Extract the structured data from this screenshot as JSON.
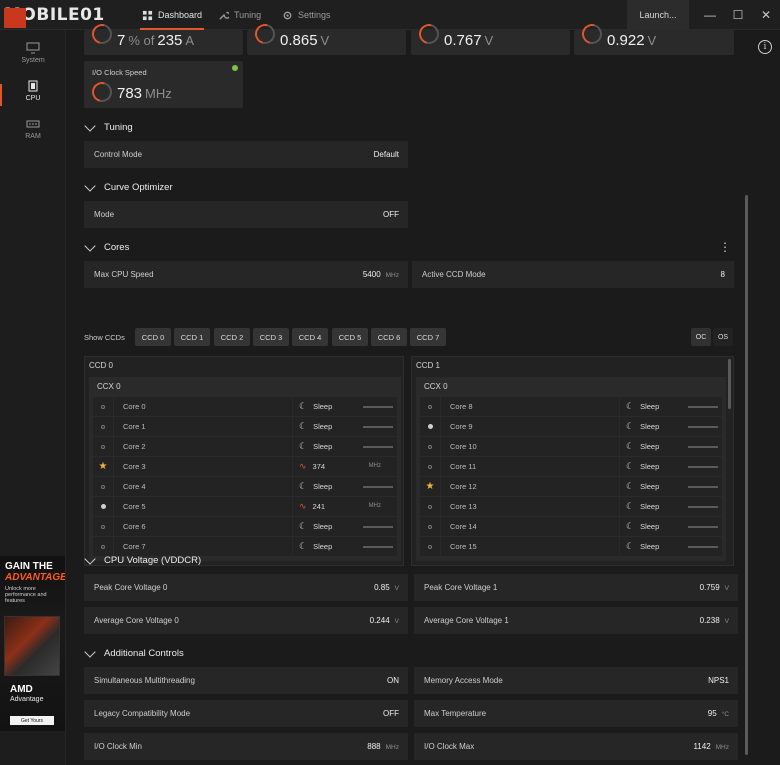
{
  "titlebar": {
    "watermark": "MOBILE01",
    "tabs": [
      {
        "label": "Dashboard",
        "icon": "grid-icon"
      },
      {
        "label": "Tuning",
        "icon": "wrench-icon"
      },
      {
        "label": "Settings",
        "icon": "gear-icon"
      }
    ],
    "launch_label": "Launch...",
    "controls": {
      "minimize": "—",
      "maximize": "☐",
      "close": "✕"
    }
  },
  "sidebar": {
    "items": [
      {
        "label": "System",
        "icon": "monitor-icon"
      },
      {
        "label": "CPU",
        "icon": "cpu-icon"
      },
      {
        "label": "RAM",
        "icon": "memory-icon"
      }
    ]
  },
  "ad": {
    "headline1": "GAIN THE",
    "headline2": "ADVANTAGE",
    "sub": "Unlock more performance and features",
    "brand": "AMD",
    "brand2": "Advantage",
    "button": "Get Yours"
  },
  "gauges": {
    "current": {
      "value": "7",
      "of": "% of",
      "max": "235",
      "unit": "A"
    },
    "v1": {
      "value": "0.865",
      "unit": "V"
    },
    "v2": {
      "value": "0.767",
      "unit": "V"
    },
    "v3": {
      "value": "0.922",
      "unit": "V"
    },
    "io_clock": {
      "label": "I/O Clock Speed",
      "value": "783",
      "unit": "MHz"
    }
  },
  "tuning": {
    "title": "Tuning",
    "control_mode_label": "Control Mode",
    "control_mode_value": "Default"
  },
  "curve": {
    "title": "Curve Optimizer",
    "mode_label": "Mode",
    "mode_value": "OFF"
  },
  "cores": {
    "title": "Cores",
    "max_speed_label": "Max CPU Speed",
    "max_speed_value": "5400",
    "max_speed_unit": "MHz",
    "active_ccd_label": "Active CCD Mode",
    "active_ccd_value": "8",
    "show_ccds_label": "Show CCDs",
    "ccd_buttons": [
      "CCD 0",
      "CCD 1",
      "CCD 2",
      "CCD 3",
      "CCD 4",
      "CCD 5",
      "CCD 6",
      "CCD 7"
    ],
    "oc_label": "OC",
    "os_label": "OS",
    "ccd0": {
      "title": "CCD 0",
      "ccx": "CCX 0",
      "rows": [
        {
          "name": "Core 0",
          "marker": "hollow",
          "state": "Sleep",
          "mhz": ""
        },
        {
          "name": "Core 1",
          "marker": "hollow",
          "state": "Sleep",
          "mhz": ""
        },
        {
          "name": "Core 2",
          "marker": "hollow",
          "state": "Sleep",
          "mhz": ""
        },
        {
          "name": "Core 3",
          "marker": "star",
          "state": "374",
          "mhz": "MHz"
        },
        {
          "name": "Core 4",
          "marker": "hollow",
          "state": "Sleep",
          "mhz": ""
        },
        {
          "name": "Core 5",
          "marker": "filled",
          "state": "241",
          "mhz": "MHz"
        },
        {
          "name": "Core 6",
          "marker": "hollow",
          "state": "Sleep",
          "mhz": ""
        },
        {
          "name": "Core 7",
          "marker": "hollow",
          "state": "Sleep",
          "mhz": ""
        }
      ]
    },
    "ccd1": {
      "title": "CCD 1",
      "ccx": "CCX 0",
      "rows": [
        {
          "name": "Core 8",
          "marker": "hollow",
          "state": "Sleep",
          "mhz": ""
        },
        {
          "name": "Core 9",
          "marker": "filled",
          "state": "Sleep",
          "mhz": ""
        },
        {
          "name": "Core 10",
          "marker": "hollow",
          "state": "Sleep",
          "mhz": ""
        },
        {
          "name": "Core 11",
          "marker": "hollow",
          "state": "Sleep",
          "mhz": ""
        },
        {
          "name": "Core 12",
          "marker": "star",
          "state": "Sleep",
          "mhz": ""
        },
        {
          "name": "Core 13",
          "marker": "hollow",
          "state": "Sleep",
          "mhz": ""
        },
        {
          "name": "Core 14",
          "marker": "hollow",
          "state": "Sleep",
          "mhz": ""
        },
        {
          "name": "Core 15",
          "marker": "hollow",
          "state": "Sleep",
          "mhz": ""
        }
      ]
    }
  },
  "voltage": {
    "title": "CPU Voltage (VDDCR)",
    "peak0_label": "Peak Core Voltage 0",
    "peak0_value": "0.85",
    "peak0_unit": "V",
    "peak1_label": "Peak Core Voltage 1",
    "peak1_value": "0.759",
    "peak1_unit": "V",
    "avg0_label": "Average Core Voltage 0",
    "avg0_value": "0.244",
    "avg0_unit": "V",
    "avg1_label": "Average Core Voltage 1",
    "avg1_value": "0.238",
    "avg1_unit": "V"
  },
  "additional": {
    "title": "Additional Controls",
    "smt_label": "Simultaneous Multithreading",
    "smt_value": "ON",
    "mem_label": "Memory Access Mode",
    "mem_value": "NPS1",
    "legacy_label": "Legacy Compatibility Mode",
    "legacy_value": "OFF",
    "maxtemp_label": "Max Temperature",
    "maxtemp_value": "95",
    "maxtemp_unit": "°C",
    "ioclkmin_label": "I/O Clock Min",
    "ioclkmin_value": "888",
    "ioclkmin_unit": "MHz",
    "ioclkmax_label": "I/O Clock Max",
    "ioclkmax_value": "1142",
    "ioclkmax_unit": "MHz"
  },
  "colors": {
    "accent": "#e2572a",
    "star": "#f2b233",
    "bg": "#1b1b1b",
    "card": "#2a2a2a"
  }
}
